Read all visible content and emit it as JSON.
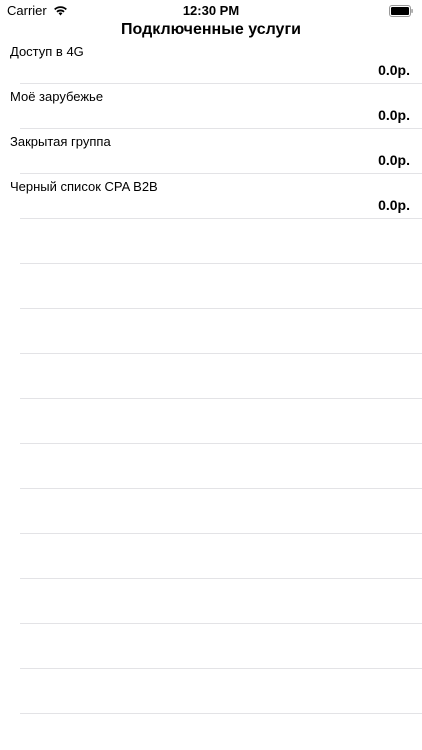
{
  "status_bar": {
    "carrier": "Carrier",
    "time": "12:30 PM"
  },
  "nav": {
    "title": "Подключенные услуги"
  },
  "services": [
    {
      "name": "Доступ в 4G",
      "price": "0.0р."
    },
    {
      "name": "Моё зарубежье",
      "price": "0.0р."
    },
    {
      "name": "Закрытая группа",
      "price": "0.0р."
    },
    {
      "name": "Черный список CPA B2B",
      "price": "0.0р."
    }
  ]
}
